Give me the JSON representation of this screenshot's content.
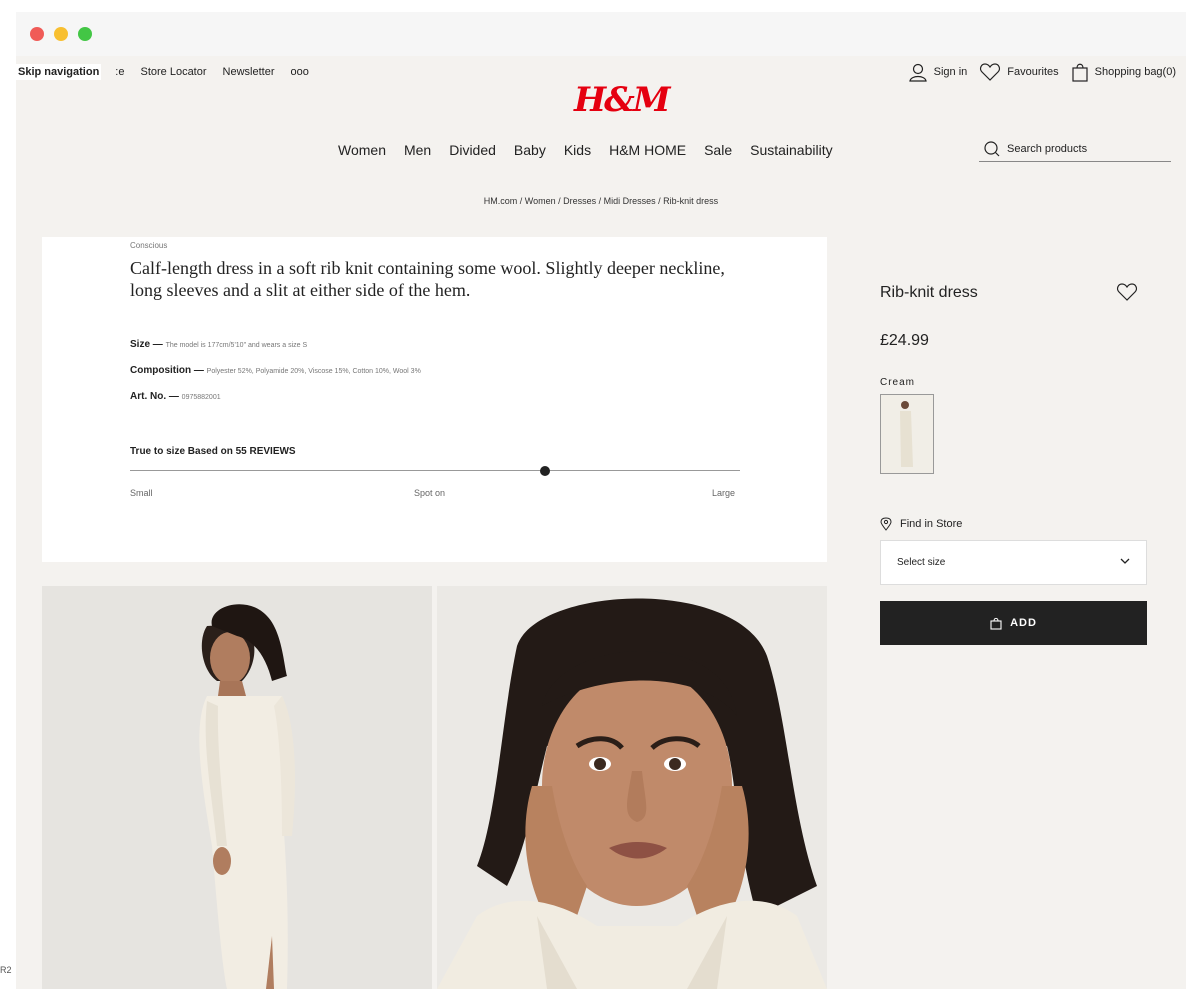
{
  "topnav": {
    "skip": "Skip navigation",
    "cut": ":e",
    "items": [
      "Store Locator",
      "Newsletter",
      "ooo"
    ]
  },
  "logo": "H&M",
  "account": {
    "sign_in": "Sign in",
    "favourites": "Favourites",
    "bag": "Shopping bag(0)"
  },
  "categories": [
    "Women",
    "Men",
    "Divided",
    "Baby",
    "Kids",
    "H&M HOME",
    "Sale",
    "Sustainability"
  ],
  "search": {
    "placeholder": "Search products"
  },
  "breadcrumb": "HM.com / Women / Dresses / Midi Dresses / Rib-knit dress",
  "description": {
    "tag": "Conscious",
    "lead": "Calf-length dress in a soft rib knit containing some wool. Slightly deeper neckline, long sleeves and a slit at either side of the hem.",
    "size_label": "Size —",
    "size_value": "The model is 177cm/5'10\" and wears a size S",
    "composition_label": "Composition —",
    "composition_value": "Polyester 52%, Polyamide 20%, Viscose 15%, Cotton 10%, Wool 3%",
    "art_label": "Art. No. —",
    "art_value": "0975882001",
    "fit_text": "True to size Based on  55 REVIEWS",
    "fit_level": 0.68,
    "fit_small": "Small",
    "fit_spot": "Spot on",
    "fit_large": "Large"
  },
  "product": {
    "title": "Rib-knit dress",
    "price": "£24.99",
    "color": "Cream",
    "find_in_store": "Find in Store",
    "select_size": "Select size",
    "add": "ADD"
  },
  "corner_text": "R2",
  "colors": {
    "brand": "#e50010",
    "add_button": "#222222",
    "background": "#f4f2ef"
  }
}
